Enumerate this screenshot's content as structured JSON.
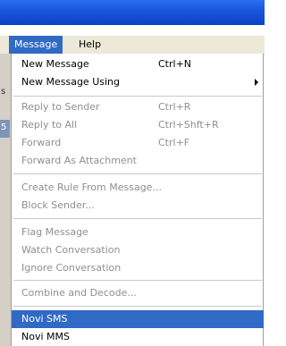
{
  "menubar": {
    "items": [
      {
        "label": "Message",
        "active": true
      },
      {
        "label": "Help",
        "active": false
      }
    ]
  },
  "background": {
    "scraps": [
      "s",
      "5"
    ]
  },
  "menu": {
    "items": [
      {
        "label": "New Message",
        "shortcut": "Ctrl+N",
        "enabled": true
      },
      {
        "label": "New Message Using",
        "shortcut": "",
        "enabled": true,
        "submenu": true,
        "submenu_icon": "chevron-right-icon"
      },
      {
        "label": "Reply to Sender",
        "shortcut": "Ctrl+R",
        "enabled": false
      },
      {
        "label": "Reply to All",
        "shortcut": "Ctrl+Shft+R",
        "enabled": false
      },
      {
        "label": "Forward",
        "shortcut": "Ctrl+F",
        "enabled": false
      },
      {
        "label": "Forward As Attachment",
        "shortcut": "",
        "enabled": false
      },
      {
        "label": "Create Rule From Message...",
        "shortcut": "",
        "enabled": false
      },
      {
        "label": "Block Sender...",
        "shortcut": "",
        "enabled": false
      },
      {
        "label": "Flag Message",
        "shortcut": "",
        "enabled": false
      },
      {
        "label": "Watch Conversation",
        "shortcut": "",
        "enabled": false
      },
      {
        "label": "Ignore Conversation",
        "shortcut": "",
        "enabled": false
      },
      {
        "label": "Combine and Decode...",
        "shortcut": "",
        "enabled": false
      },
      {
        "label": "Novi SMS",
        "shortcut": "",
        "enabled": true,
        "highlighted": true
      },
      {
        "label": "Novi MMS",
        "shortcut": "",
        "enabled": true
      }
    ]
  },
  "colors": {
    "titlebar": "#0b43c6",
    "highlight": "#316ac5",
    "disabled_text": "#8f8f8f",
    "menubar_bg": "#ece9d8"
  }
}
